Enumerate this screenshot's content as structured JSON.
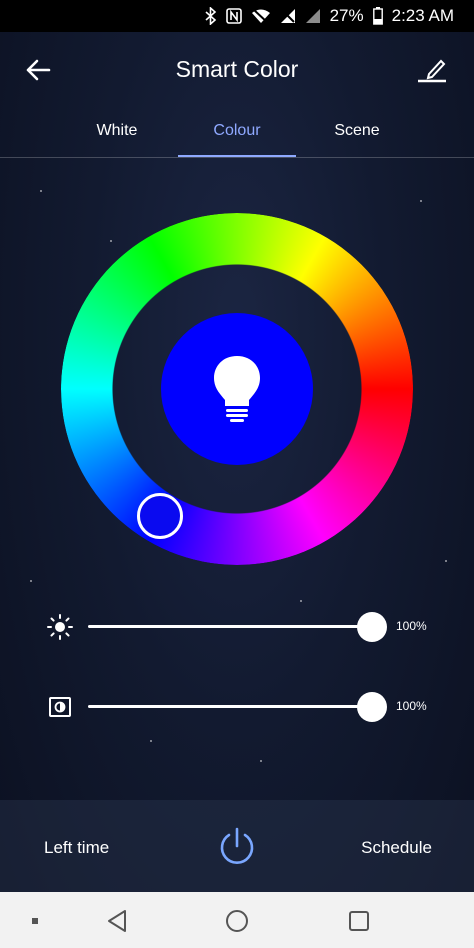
{
  "status_bar": {
    "battery_percent": "27%",
    "time": "2:23 AM",
    "icons": [
      "bluetooth-icon",
      "nfc-icon",
      "wifi-icon",
      "signal-off-icon",
      "signal-icon",
      "battery-icon"
    ]
  },
  "app_bar": {
    "title": "Smart Color",
    "back_icon": "arrow-left-icon",
    "edit_icon": "edit-icon"
  },
  "tabs": [
    {
      "label": "White",
      "active": false
    },
    {
      "label": "Colour",
      "active": true
    },
    {
      "label": "Scene",
      "active": false
    }
  ],
  "color_picker": {
    "selected_color": "#0000ff",
    "center_icon": "bulb-icon"
  },
  "sliders": [
    {
      "icon": "brightness-icon",
      "value_label": "100%",
      "level": 1.0
    },
    {
      "icon": "contrast-icon",
      "value_label": "100%",
      "level": 1.0
    }
  ],
  "bottom_bar": {
    "left_time_label": "Left time",
    "schedule_label": "Schedule",
    "power_icon": "power-icon",
    "accent": "#7aa7ff"
  },
  "nav_bar": {
    "icons": [
      "recents-dot-icon",
      "back-triangle-icon",
      "home-circle-icon",
      "overview-square-icon"
    ]
  }
}
